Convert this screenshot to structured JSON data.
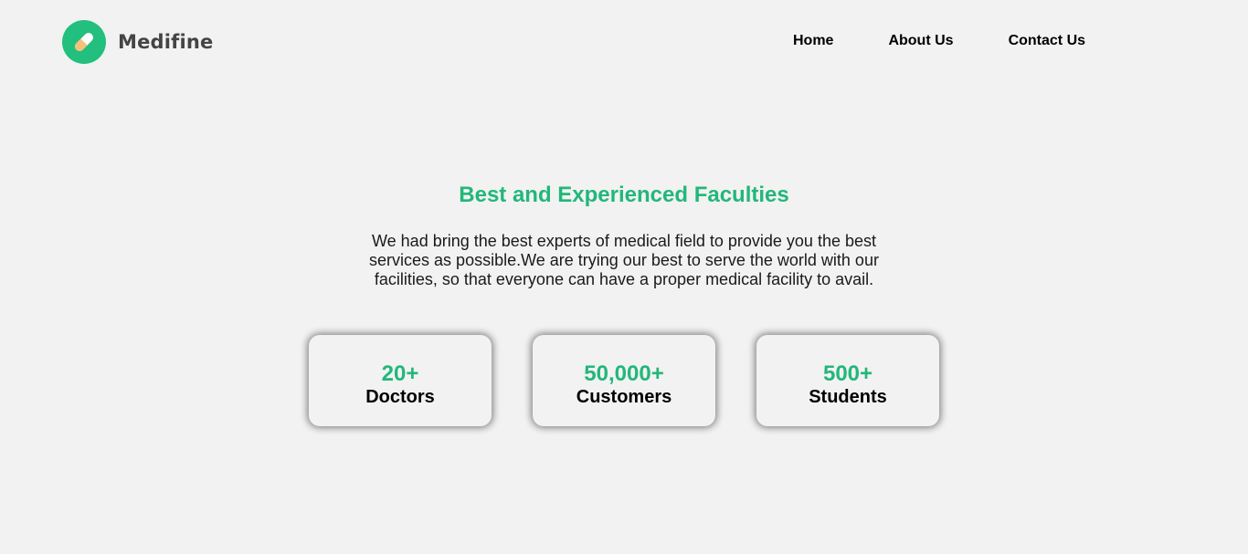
{
  "brand": {
    "name": "Medifine",
    "logo_icon": "pill-icon",
    "accent_color": "#22bf7e"
  },
  "nav": {
    "items": [
      {
        "label": "Home"
      },
      {
        "label": "About Us"
      },
      {
        "label": "Contact Us"
      }
    ]
  },
  "hero": {
    "title": "Best and Experienced Faculties",
    "description": "We had bring the best experts of medical field to provide you the best services as possible.We are trying our best to serve the world with our facilities, so that everyone can have a proper medical facility to avail."
  },
  "stats": [
    {
      "value": "20+",
      "label": "Doctors"
    },
    {
      "value": "50,000+",
      "label": "Customers"
    },
    {
      "value": "500+",
      "label": "Students"
    }
  ]
}
